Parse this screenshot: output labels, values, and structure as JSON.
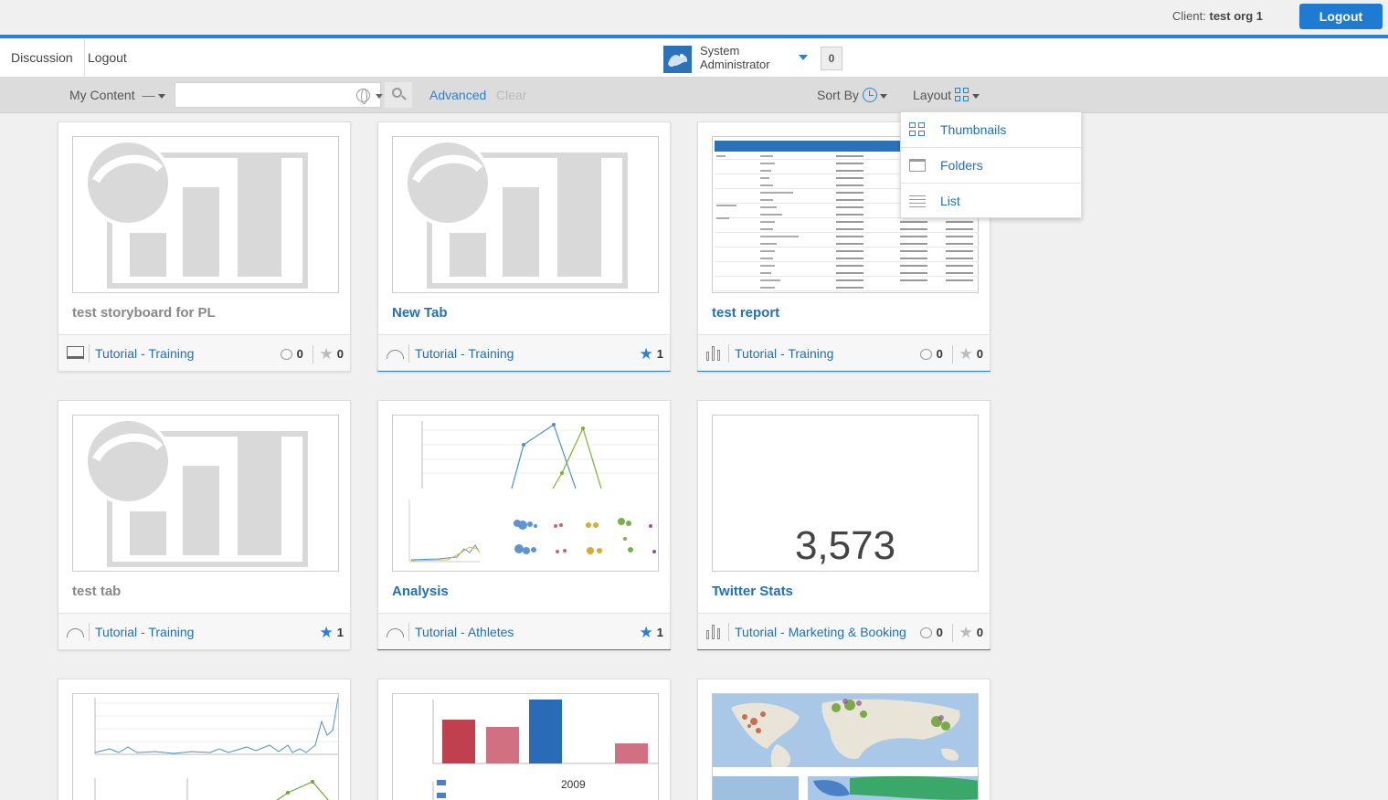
{
  "header": {
    "client_label": "Client:",
    "client_name": "test org 1",
    "logout": "Logout"
  },
  "nav": {
    "discussion": "Discussion",
    "logout": "Logout",
    "user_line1": "System",
    "user_line2": "Administrator",
    "badge_count": "0"
  },
  "filter": {
    "my_content": "My Content",
    "my_content_dash": "—",
    "search_value": "",
    "advanced": "Advanced",
    "clear": "Clear",
    "sort_by": "Sort By",
    "layout": "Layout"
  },
  "layout_menu": {
    "items": [
      {
        "label": "Thumbnails",
        "icon": "thumbnails-icon"
      },
      {
        "label": "Folders",
        "icon": "folder-icon"
      },
      {
        "label": "List",
        "icon": "list-icon"
      }
    ]
  },
  "cards": [
    {
      "title": "test storyboard for PL",
      "type_icon": "storyboard-icon",
      "category": "Tutorial - Training",
      "comments": "0",
      "stars": "0",
      "starred": false
    },
    {
      "title": "New Tab",
      "type_icon": "dashboard-gauge-icon",
      "category": "Tutorial - Training",
      "stars": "1",
      "starred": true
    },
    {
      "title": "test report",
      "type_icon": "report-bars-icon",
      "category": "Tutorial - Training",
      "comments": "0",
      "stars": "0",
      "starred": false
    },
    {
      "title": "test tab",
      "type_icon": "dashboard-gauge-icon",
      "category": "Tutorial - Training",
      "stars": "1",
      "starred": true
    },
    {
      "title": "Analysis",
      "type_icon": "dashboard-gauge-icon",
      "category": "Tutorial - Athletes",
      "stars": "1",
      "starred": true
    },
    {
      "title": "Twitter Stats",
      "type_icon": "report-bars-icon",
      "category": "Tutorial - Marketing & Booking",
      "comments": "0",
      "stars": "0",
      "starred": false,
      "big_number": "3,573"
    }
  ],
  "bottom_cards": {
    "year_label": "2009"
  },
  "colors": {
    "accent": "#2a80d5",
    "link": "#2270b8",
    "background": "#f0f0f0"
  }
}
